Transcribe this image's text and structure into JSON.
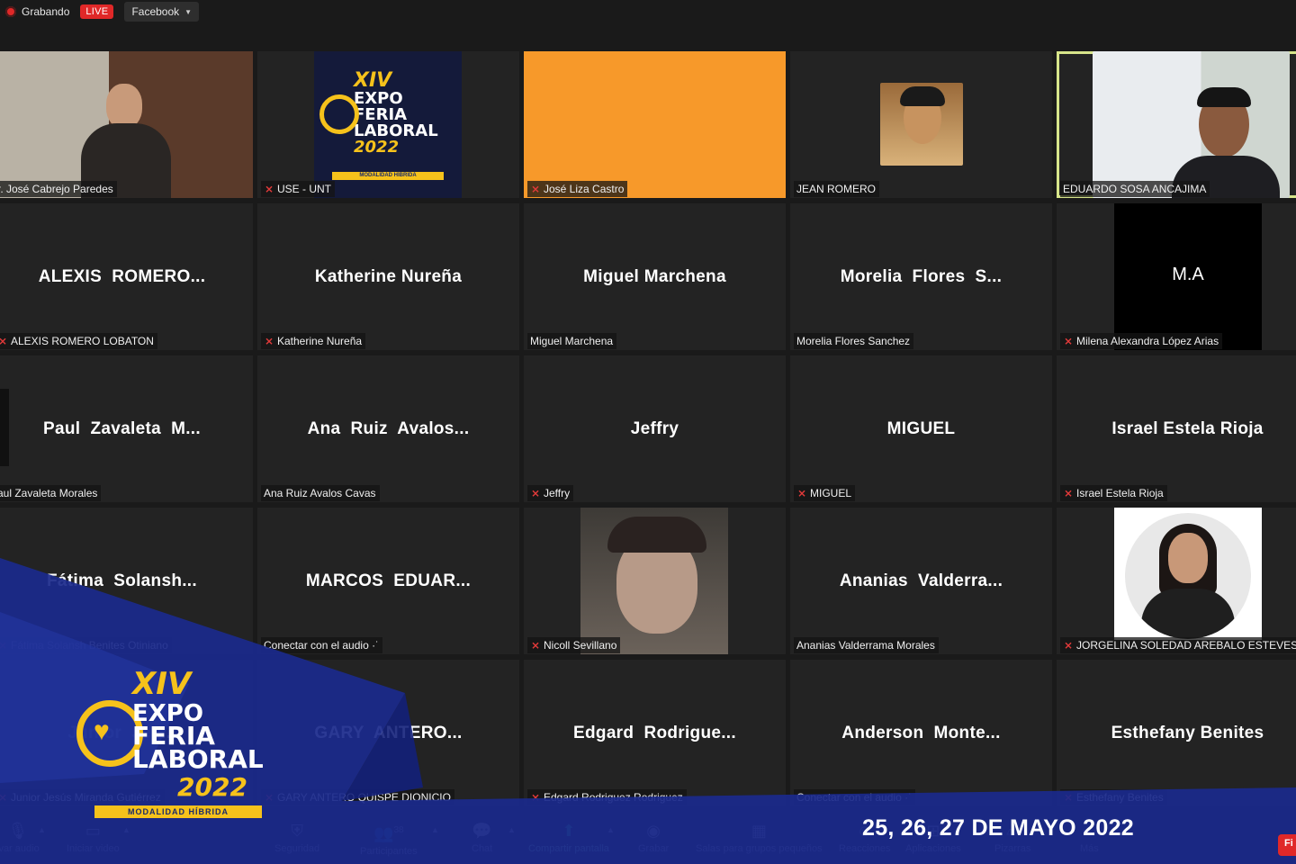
{
  "topbar": {
    "recording_label": "Grabando",
    "live_label": "LIVE",
    "stream_target": "Facebook"
  },
  "tiles": [
    {
      "big": "",
      "label": "r. José Cabrejo Paredes",
      "muted": false,
      "kind": "office"
    },
    {
      "big": "",
      "label": "USE - UNT",
      "muted": true,
      "kind": "logo"
    },
    {
      "big": "",
      "label": "José Liza Castro",
      "muted": true,
      "kind": "orange"
    },
    {
      "big": "",
      "label": "JEAN ROMERO",
      "muted": false,
      "kind": "jean"
    },
    {
      "big": "",
      "label": "EDUARDO SOSA ANCAJIMA",
      "muted": false,
      "kind": "eduardo"
    },
    {
      "big": "ALEXIS  ROMERO...",
      "label": "ALEXIS ROMERO LOBATON",
      "muted": true
    },
    {
      "big": "Katherine Nureña",
      "label": "Katherine Nureña",
      "muted": true
    },
    {
      "big": "Miguel Marchena",
      "label": "Miguel Marchena",
      "muted": false
    },
    {
      "big": "Morelia  Flores  S...",
      "label": "Morelia Flores Sanchez",
      "muted": false
    },
    {
      "big": "",
      "label": "Milena Alexandra López Arias",
      "muted": true,
      "kind": "ma",
      "initials": "M.A"
    },
    {
      "big": "Paul  Zavaleta  M...",
      "label": "aul Zavaleta Morales",
      "muted": false,
      "kind": "strip"
    },
    {
      "big": "Ana  Ruiz  Avalos...",
      "label": "Ana Ruiz Avalos Cavas",
      "muted": false
    },
    {
      "big": "Jeffry",
      "label": "Jeffry",
      "muted": true
    },
    {
      "big": "MIGUEL",
      "label": "MIGUEL",
      "muted": true
    },
    {
      "big": "Israel Estela Rioja",
      "label": "Israel Estela Rioja",
      "muted": true
    },
    {
      "big": "Fátima  Solansh...",
      "label": "Fátima Solansh Benites Otiniano",
      "muted": true
    },
    {
      "big": "MARCOS  EDUAR...",
      "label": "Conectar con el audio ·˙",
      "muted": false
    },
    {
      "big": "",
      "label": "Nicoll Sevillano",
      "muted": true,
      "kind": "nicoll"
    },
    {
      "big": "Ananias  Valderra...",
      "label": "Ananias Valderrama Morales",
      "muted": false
    },
    {
      "big": "",
      "label": "JORGELINA SOLEDAD AREBALO ESTEVES",
      "muted": true,
      "kind": "jorge"
    },
    {
      "big": "Junior  Jes...",
      "label": "Junior Jesús Miranda Gutiérrez",
      "muted": true
    },
    {
      "big": "GARY  ANTERO...",
      "label": "GARY ANTERO QUISPE DIONICIO",
      "muted": true
    },
    {
      "big": "Edgard  Rodrigue...",
      "label": "Edgard Rodriguez Rodriguez",
      "muted": true
    },
    {
      "big": "Anderson  Monte...",
      "label": "Conectar con el audio ·˙",
      "muted": false
    },
    {
      "big": "Esthefany Benites",
      "label": "Esthefany Benites",
      "muted": true
    }
  ],
  "tile_logo": {
    "roman": "XIV",
    "line1": "EXPO",
    "line2": "FERIA",
    "line3": "LABORAL",
    "year": "2022",
    "mode": "MODALIDAD HÍBRIDA"
  },
  "brand": {
    "roman": "XIV",
    "line1": "EXPO",
    "line2": "FERIA",
    "line3": "LABORAL",
    "year": "2022",
    "mode": "MODALIDAD HÍBRIDA",
    "dates": "25, 26, 27 DE MAYO 2022"
  },
  "toolbar": {
    "mute": "ivar audio",
    "video": "Iniciar video",
    "security": "Seguridad",
    "participants": "Participantes",
    "participants_count": "38",
    "chat": "Chat",
    "share": "Compartir pantalla",
    "record": "Grabar",
    "breakout": "Salas para grupos pequeños",
    "reactions": "Reacciones",
    "apps": "Aplicaciones",
    "whiteboards": "Pizarras",
    "more": "Más",
    "end": "Fi"
  },
  "colors": {
    "active_speaker": "#d7e58a",
    "mute_red": "#e23a3a",
    "brand_blue": "#1b2a8c",
    "brand_gold": "#f6c21b",
    "orange_tile": "#f7992a",
    "share_green": "#22a56a"
  }
}
